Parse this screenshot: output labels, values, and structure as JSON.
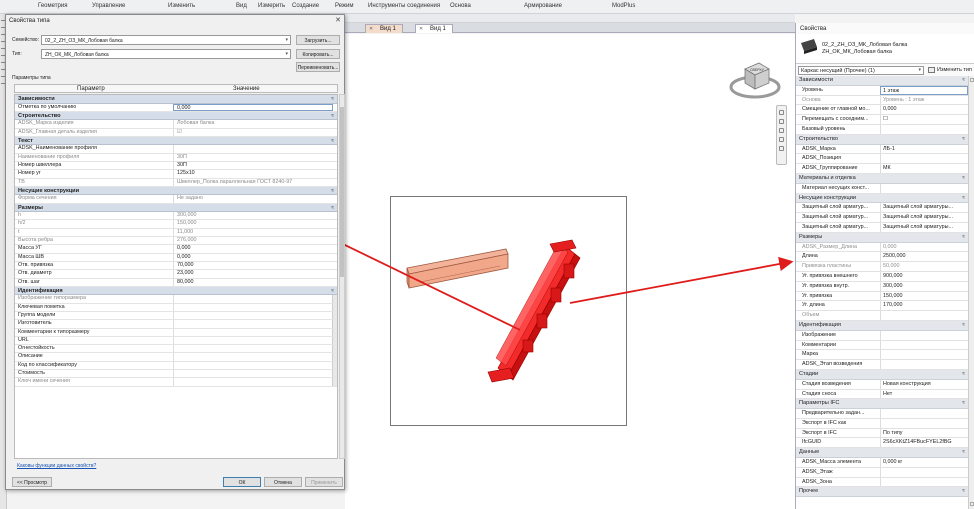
{
  "ribbon": {
    "items": [
      "Геометрия",
      "Управление",
      "Изменить",
      "Вид",
      "Измерить",
      "Создание",
      "Режим",
      "Инструменты соединения",
      "Основа",
      "Армирование",
      "ModPlus"
    ]
  },
  "tabs": [
    {
      "label": "Вид 1",
      "active": false
    },
    {
      "label": "Вид 1",
      "active": true
    }
  ],
  "dialog": {
    "title": "Свойства типа",
    "close": "✕",
    "family_label": "Семейство:",
    "family_value": "02_2_ZH_ОЗ_МК_Лобовая балка",
    "type_label": "Тип:",
    "type_value": "ZH_ОК_МК_Лобовая балка",
    "load_button": "Загрузить...",
    "duplicate_button": "Копировать...",
    "rename_button": "Переименовать...",
    "type_params_label": "Параметры типа",
    "col_param": "Параметр",
    "col_value": "Значение",
    "groups": [
      {
        "name": "Зависимости",
        "rows": [
          {
            "p": "Отметка по умолчанию",
            "v": "0,000",
            "dim": false
          }
        ]
      },
      {
        "name": "Строительство",
        "rows": [
          {
            "p": "ADSK_Марка изделия",
            "v": "Лобовая балка",
            "dim": true
          },
          {
            "p": "ADSK_Главная деталь изделия",
            "v": "☑",
            "dim": true
          }
        ]
      },
      {
        "name": "Текст",
        "rows": [
          {
            "p": "ADSK_Наименование профиля",
            "v": "",
            "dim": false
          },
          {
            "p": "Наименование профиля",
            "v": "30П",
            "dim": true
          },
          {
            "p": "Номер швеллера",
            "v": "30П",
            "dim": false
          },
          {
            "p": "Номер уг",
            "v": "125x10",
            "dim": false
          },
          {
            "p": "ТВ",
            "v": "Швеллер_Полка параллельная ГОСТ 8240-97",
            "dim": true
          }
        ]
      },
      {
        "name": "Несущие конструкции",
        "rows": [
          {
            "p": "Форма сечения",
            "v": "Не задано",
            "dim": true
          }
        ]
      },
      {
        "name": "Размеры",
        "rows": [
          {
            "p": "h",
            "v": "300,000",
            "dim": true
          },
          {
            "p": "h/2",
            "v": "150,000",
            "dim": true
          },
          {
            "p": "t",
            "v": "11,000",
            "dim": true
          },
          {
            "p": "Высота ребра",
            "v": "276,000",
            "dim": true
          },
          {
            "p": "Масса УГ",
            "v": "0,000",
            "dim": false
          },
          {
            "p": "Масса ШВ",
            "v": "0,000",
            "dim": false
          },
          {
            "p": "Отв. привязка",
            "v": "70,000",
            "dim": false
          },
          {
            "p": "Отв. диаметр",
            "v": "23,000",
            "dim": false
          },
          {
            "p": "Отв. шаг",
            "v": "80,000",
            "dim": false
          }
        ]
      },
      {
        "name": "Идентификация",
        "rows": [
          {
            "p": "Изображение типоразмера",
            "v": "",
            "dim": true
          },
          {
            "p": "Ключевая пометка",
            "v": "",
            "dim": false
          },
          {
            "p": "Группа модели",
            "v": "",
            "dim": false
          },
          {
            "p": "Изготовитель",
            "v": "",
            "dim": false
          },
          {
            "p": "Комментарии к типоразмеру",
            "v": "",
            "dim": false
          },
          {
            "p": "URL",
            "v": "",
            "dim": false
          },
          {
            "p": "Огнестойкость",
            "v": "",
            "dim": false
          },
          {
            "p": "Описание",
            "v": "",
            "dim": false
          },
          {
            "p": "Код по классификатору",
            "v": "",
            "dim": false
          },
          {
            "p": "Стоимость",
            "v": "",
            "dim": false
          },
          {
            "p": "Ключ имени сечения",
            "v": "",
            "dim": true
          }
        ]
      }
    ],
    "help_link": "Каковы функции данных свойств?",
    "preview_button": "<< Просмотр",
    "ok_button": "ОК",
    "cancel_button": "Отмена",
    "apply_button": "Применить"
  },
  "properties": {
    "title": "Свойства",
    "type_line1": "02_2_ZH_ОЗ_МК_Лобовая балка",
    "type_line2": "ZH_ОК_МК_Лобовая балка",
    "selector": "Каркас несущий (Прочее) (1)",
    "edit_type": "Изменить тип",
    "groups": [
      {
        "name": "Зависимости",
        "rows": [
          {
            "p": "Уровень",
            "v": "1 этаж",
            "dim": false,
            "boxed": true
          },
          {
            "p": "Основа",
            "v": "Уровень : 1 этаж",
            "dim": true
          },
          {
            "p": "Смещение от главной мо...",
            "v": "0,000",
            "dim": false
          },
          {
            "p": "Перемещать с соседним...",
            "v": "☐",
            "dim": false
          },
          {
            "p": "Базовый уровень",
            "v": "",
            "dim": false
          }
        ]
      },
      {
        "name": "Строительство",
        "rows": [
          {
            "p": "ADSK_Марка",
            "v": "ЛБ-1",
            "dim": false
          },
          {
            "p": "ADSK_Позиция",
            "v": "",
            "dim": false
          },
          {
            "p": "ADSK_Группирование",
            "v": "МК",
            "dim": false
          }
        ]
      },
      {
        "name": "Материалы и отделка",
        "rows": [
          {
            "p": "Материал несущих конст...",
            "v": "",
            "dim": false
          }
        ]
      },
      {
        "name": "Несущие конструкции",
        "rows": [
          {
            "p": "Защитный слой арматур...",
            "v": "Защитный слой арматуры...",
            "dim": false
          },
          {
            "p": "Защитный слой арматур...",
            "v": "Защитный слой арматуры...",
            "dim": false
          },
          {
            "p": "Защитный слой арматур...",
            "v": "Защитный слой арматуры...",
            "dim": false
          }
        ]
      },
      {
        "name": "Размеры",
        "rows": [
          {
            "p": "ADSK_Размер_Длина",
            "v": "0,000",
            "dim": true
          },
          {
            "p": "Длина",
            "v": "2500,000",
            "dim": false
          },
          {
            "p": "Привязка пластины",
            "v": "50,000",
            "dim": true
          },
          {
            "p": "Уг. привязка внешнего",
            "v": "900,000",
            "dim": false
          },
          {
            "p": "Уг. привязка внутр.",
            "v": "300,000",
            "dim": false
          },
          {
            "p": "Уг. привязка",
            "v": "150,000",
            "dim": false
          },
          {
            "p": "Уг. длина",
            "v": "170,000",
            "dim": false
          },
          {
            "p": "Объем",
            "v": "",
            "dim": true
          }
        ]
      },
      {
        "name": "Идентификация",
        "rows": [
          {
            "p": "Изображение",
            "v": "",
            "dim": false
          },
          {
            "p": "Комментарии",
            "v": "",
            "dim": false
          },
          {
            "p": "Марка",
            "v": "",
            "dim": false
          },
          {
            "p": "ADSK_Этап возведения",
            "v": "",
            "dim": false
          }
        ]
      },
      {
        "name": "Стадии",
        "rows": [
          {
            "p": "Стадия возведения",
            "v": "Новая конструкция",
            "dim": false
          },
          {
            "p": "Стадия сноса",
            "v": "Нет",
            "dim": false
          }
        ]
      },
      {
        "name": "Параметры IFC",
        "rows": [
          {
            "p": "Предварительно задан...",
            "v": "",
            "dim": false
          },
          {
            "p": "Экспорт в IFC как",
            "v": "",
            "dim": false
          },
          {
            "p": "Экспорт в IFC",
            "v": "По типу",
            "dim": false
          },
          {
            "p": "IfcGUID",
            "v": "2S6cXKtZ14FBucFYEL2fBG",
            "dim": false
          }
        ]
      },
      {
        "name": "Данные",
        "rows": [
          {
            "p": "ADSK_Масса элемента",
            "v": "0,000 кг",
            "dim": false
          },
          {
            "p": "ADSK_Этаж",
            "v": "",
            "dim": false
          },
          {
            "p": "ADSK_Зона",
            "v": "",
            "dim": false
          }
        ]
      },
      {
        "name": "Прочее",
        "rows": []
      }
    ]
  },
  "viewcube": {
    "top_label": "СВЕРХУ"
  },
  "colors": {
    "accent_red": "#e01b1b",
    "beam_red": "#f22a2a",
    "beam_peach": "#f3b39a",
    "group_bg": "#d5dde8"
  }
}
